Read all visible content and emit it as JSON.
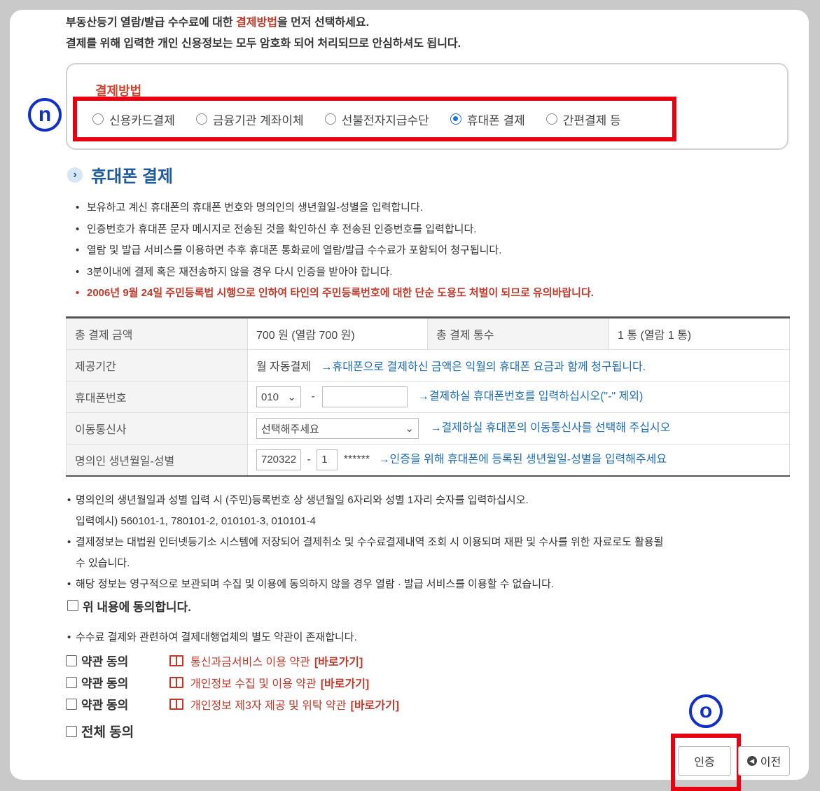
{
  "intro": {
    "line1_pre": "부동산등기 열람/발급 수수료에 대한 ",
    "line1_highlight": "결제방법",
    "line1_post": "을 먼저 선택하세요.",
    "line2": "결제를 위해 입력한 개인 신용정보는 모두 암호화 되어 처리되므로 안심하셔도 됩니다."
  },
  "payment": {
    "title": "결제방법",
    "options": [
      "신용카드결제",
      "금융기관 계좌이체",
      "선불전자지급수단",
      "휴대폰 결제",
      "간편결제 등"
    ],
    "selected": "휴대폰 결제"
  },
  "markers": {
    "n": "n",
    "o": "o"
  },
  "section": {
    "title": "휴대폰 결제"
  },
  "notes": [
    "보유하고 계신 휴대폰의 휴대폰 번호와 명의인의 생년월일-성별을 입력합니다.",
    "인증번호가 휴대폰 문자 메시지로 전송된 것을 확인하신 후 전송된 인증번호를 입력합니다.",
    "열람 및 발급 서비스를 이용하면 추후 휴대폰 통화료에 열람/발급 수수료가 포함되어 청구됩니다.",
    "3분이내에 결제 혹은 재전송하지 않을 경우 다시 인증을 받아야 합니다.",
    "2006년 9월 24일 주민등록법 시행으로 인하여 타인의 주민등록번호에 대한 단순 도용도 처벌이 되므로 유의바랍니다."
  ],
  "table": {
    "total_amount_label": "총 결제 금액",
    "total_amount_value": "700 원 (열람 700 원)",
    "total_count_label": "총 결제 통수",
    "total_count_value": "1 통 (열람 1 통)",
    "period_label": "제공기간",
    "period_value": "월 자동결제",
    "period_note": "→휴대폰으로 결제하신 금액은 익월의 휴대폰 요금과 함께 청구됩니다.",
    "phone_label": "휴대폰번호",
    "phone_prefix": "010",
    "phone_dash": "-",
    "phone_note": "→결제하실 휴대폰번호를 입력하십시오(\"-\" 제외)",
    "carrier_label": "이동통신사",
    "carrier_value": "선택해주세요",
    "carrier_note": "→결제하실 휴대폰의 이동통신사를 선택해 주십시오",
    "birth_label": "명의인 생년월일-성별",
    "birth_value": "720322",
    "birth_dash": "-",
    "gender_value": "1",
    "masked": "******",
    "birth_note": "→인증을 위해 휴대폰에 등록된 생년월일-성별을 입력해주세요"
  },
  "notes2": {
    "line1": "명의인의 생년월일과 성별 입력 시 (주민)등록번호 상 생년월일 6자리와 성별 1자리 숫자를 입력하십시오.",
    "line1b": "입력예시) 560101-1, 780101-2, 010101-3, 010101-4",
    "line2": "결제정보는 대법원 인터넷등기소 시스템에 저장되어 결제취소 및 수수료결제내역 조회 시 이용되며 재판 및 수사를 위한 자료로도 활용될",
    "line2b": "수 있습니다.",
    "line3": "해당 정보는 영구적으로 보관되며 수집 및 이용에 동의하지 않을 경우 열람 · 발급 서비스를 이용할 수 없습니다.",
    "agree": "위 내용에 동의합니다.",
    "line4": "수수료 결제와 관련하여 결제대행업체의 별도 약관이 존재합니다."
  },
  "terms": [
    {
      "check": "약관 동의",
      "link": "통신과금서비스 이용 약관",
      "go": "[바로가기]"
    },
    {
      "check": "약관 동의",
      "link": "개인정보 수집 및 이용 약관",
      "go": "[바로가기]"
    },
    {
      "check": "약관 동의",
      "link": "개인정보 제3자 제공 및 위탁 약관",
      "go": "[바로가기]"
    }
  ],
  "agree_all": "전체 동의",
  "buttons": {
    "verify": "인증",
    "prev": "이전"
  }
}
